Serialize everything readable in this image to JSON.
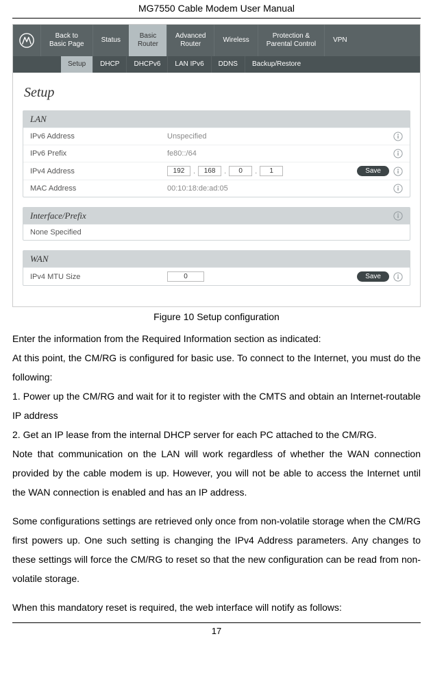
{
  "doc_title": "MG7550 Cable Modem User Manual",
  "page_number": "17",
  "screenshot": {
    "nav_main": [
      {
        "line1": "Back to",
        "line2": "Basic Page"
      },
      {
        "line1": "Status",
        "line2": ""
      },
      {
        "line1": "Basic",
        "line2": "Router",
        "active": true
      },
      {
        "line1": "Advanced",
        "line2": "Router"
      },
      {
        "line1": "Wireless",
        "line2": ""
      },
      {
        "line1": "Protection &",
        "line2": "Parental Control"
      },
      {
        "line1": "VPN",
        "line2": ""
      }
    ],
    "nav_sub": [
      {
        "label": "Setup",
        "active": true
      },
      {
        "label": "DHCP"
      },
      {
        "label": "DHCPv6"
      },
      {
        "label": "LAN IPv6"
      },
      {
        "label": "DDNS"
      },
      {
        "label": "Backup/Restore"
      }
    ],
    "heading": "Setup",
    "lan": {
      "title": "LAN",
      "ipv6_addr_label": "IPv6 Address",
      "ipv6_addr_value": "Unspecified",
      "ipv6_prefix_label": "IPv6 Prefix",
      "ipv6_prefix_value": "fe80::/64",
      "ipv4_addr_label": "IPv4 Address",
      "ipv4_octets": [
        "192",
        "168",
        "0",
        "1"
      ],
      "mac_label": "MAC Address",
      "mac_value": "00:10:18:de:ad:05",
      "save_label": "Save"
    },
    "iface": {
      "title": "Interface/Prefix",
      "none_label": "None Specified"
    },
    "wan": {
      "title": "WAN",
      "mtu_label": "IPv4 MTU Size",
      "mtu_value": "0",
      "save_label": "Save"
    }
  },
  "figure_caption": "Figure 10 Setup configuration",
  "paragraphs": {
    "p1": "Enter the information from the Required Information section as indicated:",
    "p2": "At this point, the CM/RG is configured for basic use. To connect to the Internet, you must do the following:",
    "p3": "1. Power up the CM/RG and wait for it to register with the CMTS and obtain an Internet-routable IP address",
    "p4": "2. Get an IP lease from the internal DHCP server for each PC attached to the CM/RG.",
    "p5": "Note that communication on the LAN will work regardless of whether the WAN connection provided by the cable modem is up. However, you will not be able to access the Internet until the WAN connection is enabled and has an IP address.",
    "p6": "Some configurations settings are retrieved only once from non-volatile storage when the CM/RG first powers up. One such setting is changing the IPv4 Address parameters. Any changes to these settings will force the CM/RG to reset so that the new configuration can be read from non-volatile storage.",
    "p7": "When this mandatory reset is required, the web interface will notify as follows:"
  }
}
